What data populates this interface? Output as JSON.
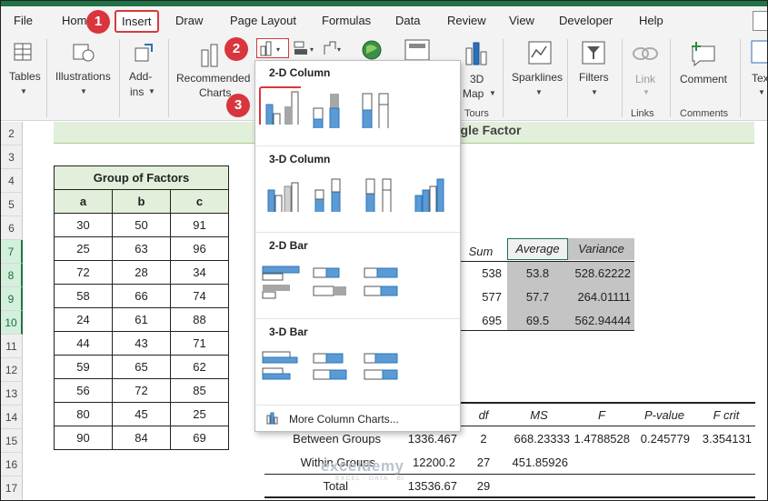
{
  "ribbon_tabs": [
    "File",
    "Home",
    "Insert",
    "Draw",
    "Page Layout",
    "Formulas",
    "Data",
    "Review",
    "View",
    "Developer",
    "Help"
  ],
  "ribbon": {
    "tables": "Tables",
    "illustrations": "Illustrations",
    "addins_1": "Add-",
    "addins_2": "ins",
    "recommended_1": "Recommended",
    "recommended_2": "Charts",
    "map_1": "3D",
    "map_2": "Map",
    "tours": "Tours",
    "sparklines": "Sparklines",
    "filters": "Filters",
    "link": "Link",
    "links": "Links",
    "comment": "Comment",
    "comments": "Comments",
    "text": "Tex"
  },
  "callouts": [
    "1",
    "2",
    "3"
  ],
  "dropdown": {
    "sections": [
      "2-D Column",
      "3-D Column",
      "2-D Bar",
      "3-D Bar"
    ],
    "more": "More Column Charts..."
  },
  "row_numbers": [
    "2",
    "3",
    "4",
    "5",
    "6",
    "7",
    "8",
    "9",
    "10",
    "11",
    "12",
    "13",
    "14",
    "15",
    "16",
    "17"
  ],
  "banner": "ngle Factor",
  "group_table": {
    "title": "Group of Factors",
    "headers": [
      "a",
      "b",
      "c"
    ],
    "rows": [
      [
        "30",
        "50",
        "91"
      ],
      [
        "25",
        "63",
        "96"
      ],
      [
        "72",
        "28",
        "34"
      ],
      [
        "58",
        "66",
        "74"
      ],
      [
        "24",
        "61",
        "88"
      ],
      [
        "44",
        "43",
        "71"
      ],
      [
        "59",
        "65",
        "62"
      ],
      [
        "56",
        "72",
        "85"
      ],
      [
        "80",
        "45",
        "25"
      ],
      [
        "90",
        "84",
        "69"
      ]
    ]
  },
  "summary": {
    "headers": [
      "Sum",
      "Average",
      "Variance"
    ],
    "rows": [
      [
        "538",
        "53.8",
        "528.62222"
      ],
      [
        "577",
        "57.7",
        "264.01111"
      ],
      [
        "695",
        "69.5",
        "562.94444"
      ]
    ]
  },
  "anova": {
    "headers": [
      "df",
      "MS",
      "F",
      "P-value",
      "F crit"
    ],
    "rows": [
      [
        "Between Groups",
        "1336.467",
        "2",
        "668.23333",
        "1.4788528",
        "0.245779",
        "3.354131"
      ],
      [
        "Within Groups",
        "12200.2",
        "27",
        "451.85926",
        "",
        "",
        ""
      ],
      [
        "Total",
        "13536.67",
        "29",
        "",
        "",
        "",
        ""
      ]
    ]
  },
  "watermark": "exceldemy",
  "watermark_sub": "EXCEL · DATA · BI"
}
